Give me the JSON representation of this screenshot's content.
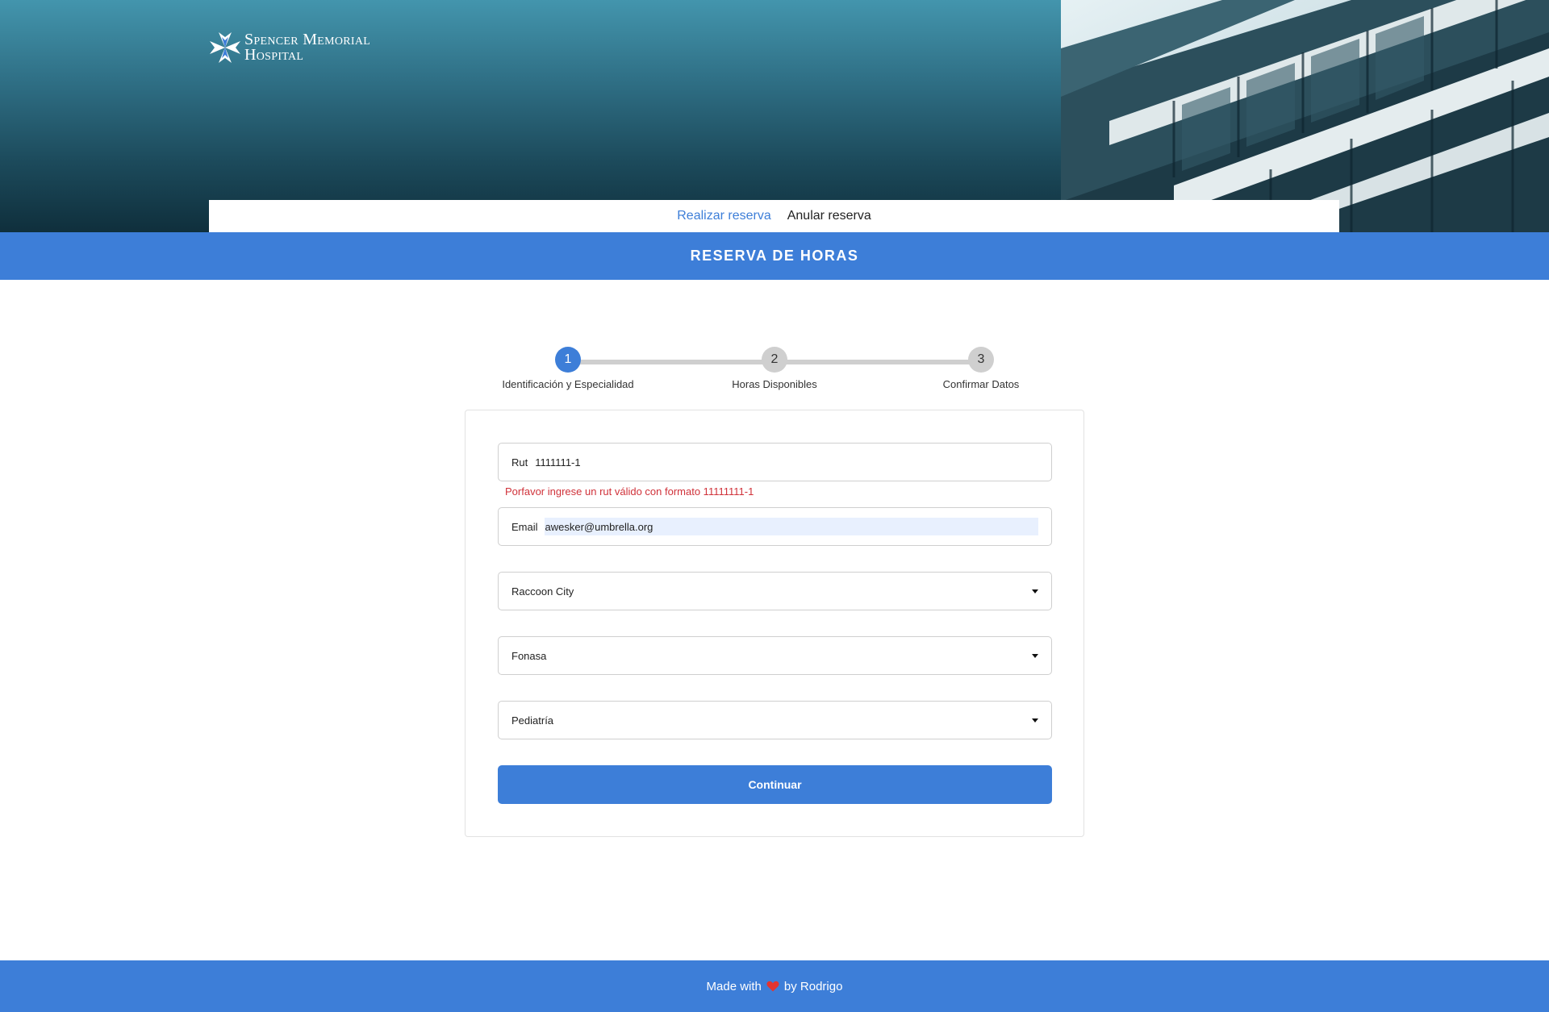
{
  "header": {
    "logo_line1": "Spencer Memorial",
    "logo_line2": "Hospital",
    "nav": {
      "realizar": "Realizar reserva",
      "anular": "Anular reserva"
    }
  },
  "title": "RESERVA DE HORAS",
  "stepper": {
    "current": 1,
    "steps": [
      {
        "number": "1",
        "label": "Identificación y Especialidad"
      },
      {
        "number": "2",
        "label": "Horas Disponibles"
      },
      {
        "number": "3",
        "label": "Confirmar Datos"
      }
    ]
  },
  "form": {
    "rut": {
      "label": "Rut",
      "value": "1111111-1"
    },
    "rut_error": "Porfavor ingrese un rut válido con formato 11111111-1",
    "email": {
      "label": "Email",
      "value": "awesker@umbrella.org"
    },
    "city": "Raccoon City",
    "insurance": "Fonasa",
    "specialty": "Pediatría",
    "submit_label": "Continuar"
  },
  "footer": {
    "made_with": "Made with",
    "by": "by Rodrigo"
  },
  "colors": {
    "accent": "#3d7ed8",
    "error": "#d0323a",
    "heart": "#e3342f"
  }
}
